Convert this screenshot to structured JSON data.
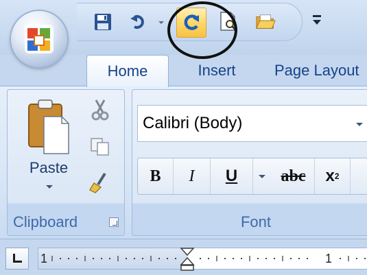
{
  "quick_access": {
    "items": [
      {
        "name": "save-button",
        "icon": "floppy-disk-icon"
      },
      {
        "name": "undo-button",
        "icon": "undo-arrow-icon"
      },
      {
        "name": "redo-button",
        "icon": "redo-arrow-icon"
      },
      {
        "name": "print-preview-button",
        "icon": "document-magnifier-icon"
      },
      {
        "name": "open-button",
        "icon": "folder-open-icon"
      }
    ],
    "customize_icon": "customize-dropdown-icon",
    "highlight": "redo-button"
  },
  "office_button": {
    "icon": "office-logo-icon"
  },
  "tabs": [
    {
      "label": "Home",
      "active": true
    },
    {
      "label": "Insert",
      "active": false
    },
    {
      "label": "Page Layout",
      "active": false
    }
  ],
  "groups": {
    "clipboard": {
      "label": "Clipboard",
      "paste_label": "Paste",
      "tools": [
        "scissors-icon",
        "copy-icon",
        "format-painter-icon"
      ]
    },
    "font": {
      "label": "Font",
      "font_name": "Calibri (Body)",
      "buttons": {
        "bold": "B",
        "italic": "I",
        "underline": "U",
        "strikethrough": "abc",
        "subscript_base": "x",
        "subscript_sub": "2"
      }
    }
  },
  "ruler": {
    "left_number": "1",
    "right_number": "1"
  },
  "colors": {
    "ribbon_text": "#15428b",
    "highlight_fill": "#ffd86a",
    "annotation_circle": "#111111"
  }
}
